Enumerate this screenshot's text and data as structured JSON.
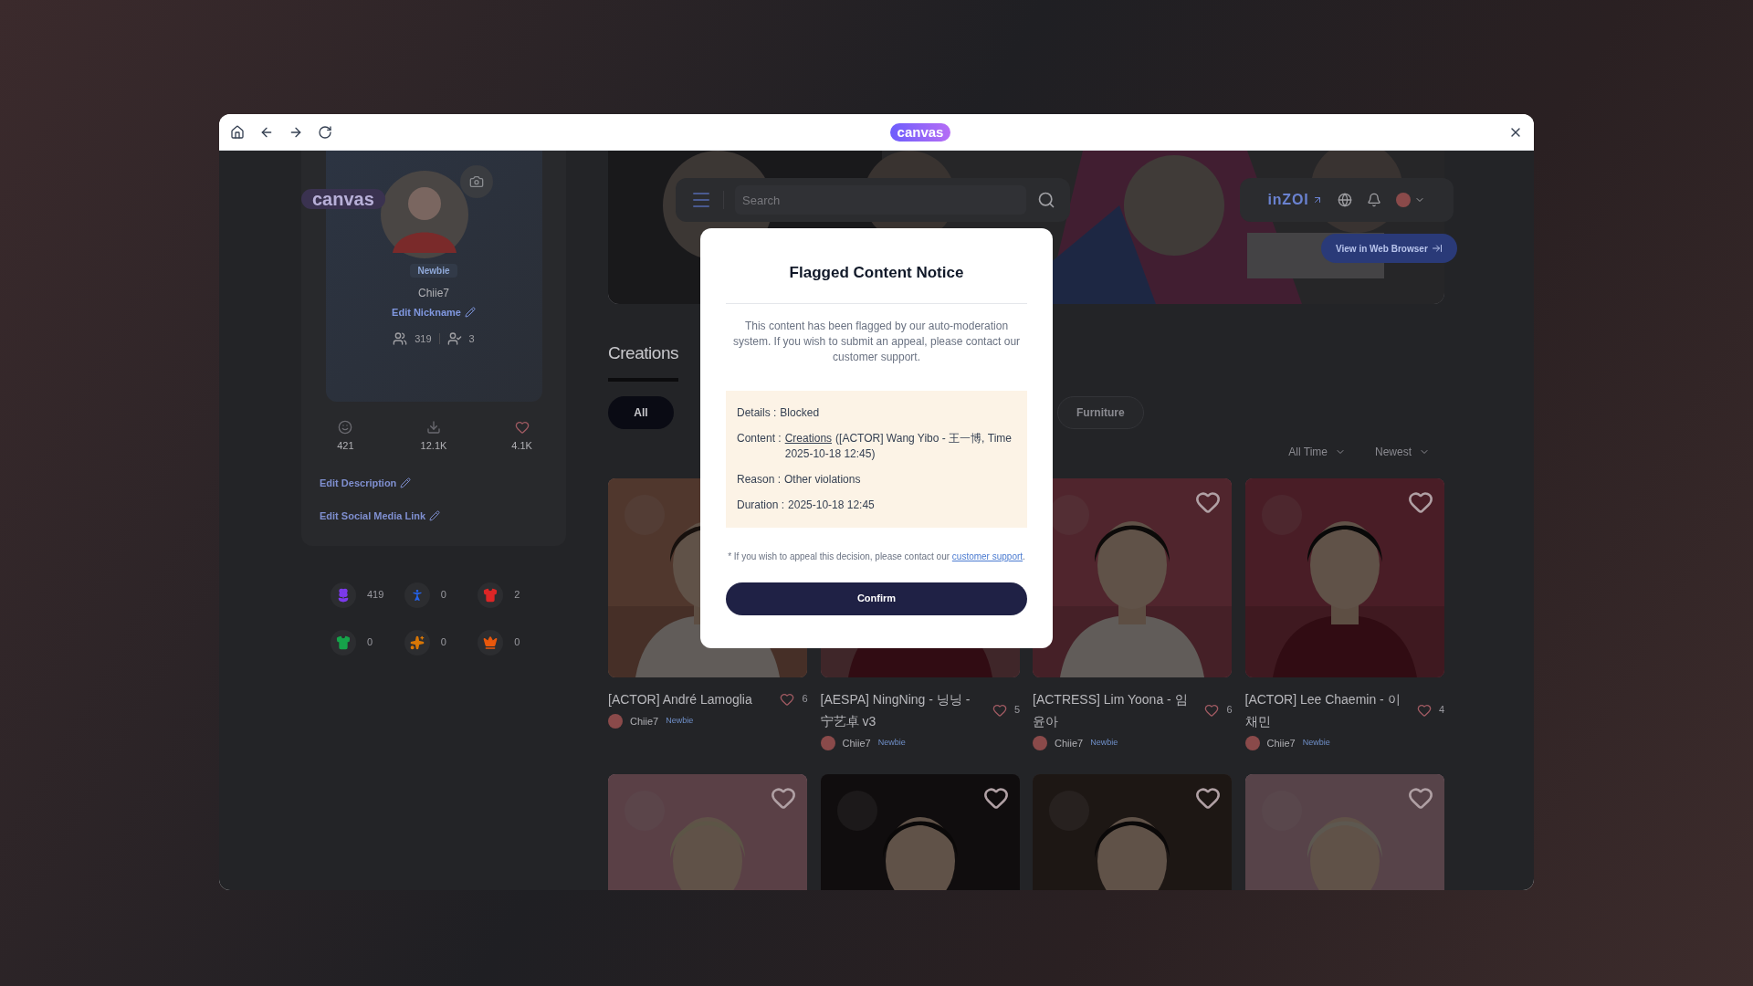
{
  "browser": {
    "logo": "canvas"
  },
  "header": {
    "search": {
      "placeholder": "Search"
    },
    "brand": "inZOI",
    "web_button": "View in Web Browser"
  },
  "profile": {
    "logo": "canvas",
    "badge": "Newbie",
    "name": "Chiie7",
    "edit_nickname": "Edit Nickname",
    "followers": "319",
    "following": "3",
    "stats": [
      {
        "kind": "creations",
        "value": "421"
      },
      {
        "kind": "downloads",
        "value": "12.1K"
      },
      {
        "kind": "likes",
        "value": "4.1K"
      }
    ],
    "links": [
      "Edit Description",
      "Edit Social Media Link"
    ],
    "categories": [
      {
        "kind": "flower",
        "count": "419",
        "color": "#7c3aed"
      },
      {
        "kind": "figure",
        "count": "0",
        "color": "#2563eb"
      },
      {
        "kind": "dress",
        "count": "2",
        "color": "#dc2626"
      },
      {
        "kind": "top",
        "count": "0",
        "color": "#16a34a"
      },
      {
        "kind": "item",
        "count": "0",
        "color": "#d97706"
      },
      {
        "kind": "hair",
        "count": "0",
        "color": "#ea580c"
      }
    ]
  },
  "tabs": [
    {
      "label": "Creations",
      "selected": true
    }
  ],
  "filters": [
    {
      "label": "All",
      "selected": true
    },
    {
      "label": "Furniture",
      "selected": false
    }
  ],
  "sort": [
    "All Time",
    "Newest"
  ],
  "cards": [
    {
      "title": "[ACTOR] André Lamoglia",
      "likes": "6",
      "author": "Chiie7",
      "badge": "Newbie",
      "heart_shown": false
    },
    {
      "title": "[AESPA] NingNing - 닝닝 - 宁艺卓 v3",
      "likes": "5",
      "author": "Chiie7",
      "badge": "Newbie",
      "heart_shown": false
    },
    {
      "title": "[ACTRESS] Lim Yoona - 임윤아",
      "likes": "6",
      "author": "Chiie7",
      "badge": "Newbie",
      "heart_shown": true
    },
    {
      "title": "[ACTOR] Lee Chaemin - 이채민",
      "likes": "4",
      "author": "Chiie7",
      "badge": "Newbie",
      "heart_shown": true
    }
  ],
  "cards_row2": [
    {
      "heart_shown": true
    },
    {
      "heart_shown": true
    },
    {
      "heart_shown": true
    },
    {
      "heart_shown": true
    }
  ],
  "modal": {
    "title": "Flagged Content Notice",
    "message": "This content has been flagged by our auto-moderation system. If you wish to submit an appeal, please contact our customer support.",
    "details": [
      {
        "label": "Details :",
        "value": "Blocked"
      },
      {
        "label": "Content :",
        "link": "Creations",
        "value": "([ACTOR] Wang Yibo - 王一博, Time 2025-10-18 12:45)"
      },
      {
        "label": "Reason :",
        "value": "Other violations"
      },
      {
        "label": "Duration :",
        "value": "2025-10-18 12:45"
      }
    ],
    "note": "* If you wish to appeal this decision, please contact our",
    "note_link": "customer support",
    "note_end": ".",
    "confirm": "Confirm"
  }
}
